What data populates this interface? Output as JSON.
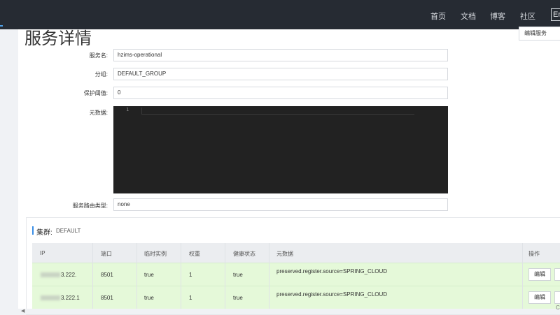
{
  "nav": {
    "items": [
      "首页",
      "文档",
      "博客",
      "社区"
    ],
    "lang": "En"
  },
  "page": {
    "title": "服务详情",
    "edit_button": "编辑服务"
  },
  "form": {
    "service_name": {
      "label": "服务名:",
      "value": "hzims-operational"
    },
    "group": {
      "label": "分组:",
      "value": "DEFAULT_GROUP"
    },
    "protect_threshold": {
      "label": "保护阈值:",
      "value": "0"
    },
    "metadata": {
      "label": "元数据:",
      "line_number": "1"
    },
    "route_type": {
      "label": "服务路由类型:",
      "value": "none"
    }
  },
  "cluster": {
    "title": "集群:",
    "name": "DEFAULT"
  },
  "table": {
    "headers": [
      "IP",
      "端口",
      "临时实例",
      "权重",
      "健康状态",
      "元数据",
      "操作"
    ],
    "rows": [
      {
        "ip": "3.222.",
        "port": "8501",
        "ephemeral": "true",
        "weight": "1",
        "healthy": "true",
        "metadata": "preserved.register.source=SPRING_CLOUD",
        "action": "编辑"
      },
      {
        "ip": "3.222.1",
        "port": "8501",
        "ephemeral": "true",
        "weight": "1",
        "healthy": "true",
        "metadata": "preserved.register.source=SPRING_CLOUD",
        "action": "编辑"
      }
    ]
  },
  "colors": {
    "topbar": "#262b33",
    "row_highlight": "#e5f9d9",
    "accent": "#3a8ee6",
    "editor": "#222222"
  },
  "footer": {
    "corner_text": "C"
  }
}
